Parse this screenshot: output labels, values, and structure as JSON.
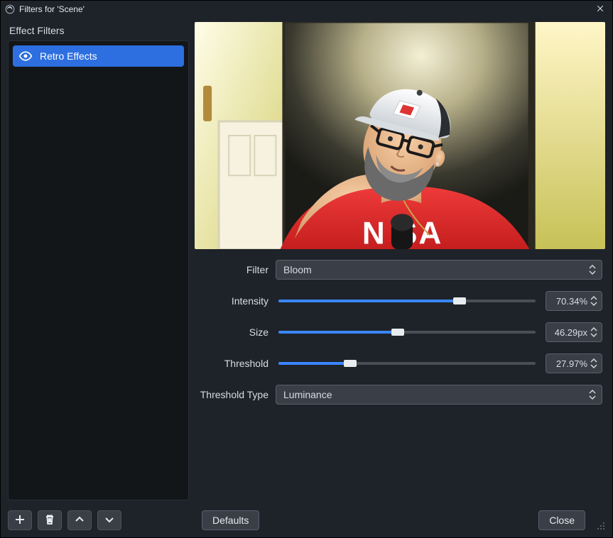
{
  "window": {
    "title": "Filters for 'Scene'"
  },
  "sidebar": {
    "section_label": "Effect Filters",
    "items": [
      {
        "label": "Retro Effects",
        "selected": true
      }
    ]
  },
  "toolbar_left": {
    "add": "add-filter",
    "delete": "delete-filter",
    "move_up": "move-up",
    "move_down": "move-down"
  },
  "params": {
    "filter": {
      "label": "Filter",
      "value": "Bloom"
    },
    "intensity": {
      "label": "Intensity",
      "value_text": "70.34%",
      "percent": 70.34
    },
    "size": {
      "label": "Size",
      "value_text": "46.29px",
      "percent": 46.29
    },
    "threshold": {
      "label": "Threshold",
      "value_text": "27.97%",
      "percent": 27.97
    },
    "threshold_type": {
      "label": "Threshold Type",
      "value": "Luminance"
    }
  },
  "buttons": {
    "defaults": "Defaults",
    "close": "Close"
  }
}
